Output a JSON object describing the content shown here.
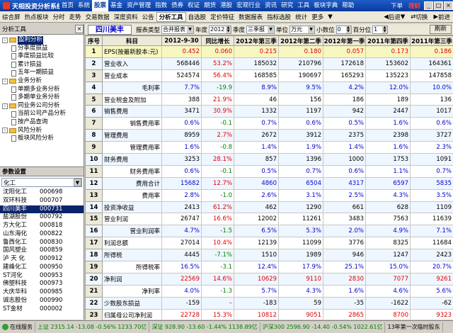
{
  "app": {
    "title": "天相投资分析系统"
  },
  "menu": [
    "首页",
    "系统",
    "股票",
    "基金",
    "资产管理",
    "指数",
    "债券",
    "权证",
    "期货",
    "港股",
    "宏观行业",
    "资讯",
    "研究",
    "工具",
    "板块字典",
    "帮助"
  ],
  "menu_active": 2,
  "menu_right": [
    "下单",
    "理财"
  ],
  "toolbar": [
    "综合屏",
    "热点板块",
    "分时",
    "走势",
    "交易数据",
    "深度资料",
    "公告",
    "分析工具",
    "自选股",
    "定价特征",
    "数据报表",
    "指标选股",
    "统计",
    "更多"
  ],
  "toolbar_active": 7,
  "toolbar_right": [
    "后退",
    "切换",
    "前进"
  ],
  "left": {
    "title": "分析工具",
    "tree": [
      {
        "t": "盈利分析",
        "lvl": 0,
        "pm": "-",
        "sel": true
      },
      {
        "t": "分季度损益",
        "lvl": 1
      },
      {
        "t": "季度损益比较",
        "lvl": 1
      },
      {
        "t": "累计损益",
        "lvl": 1
      },
      {
        "t": "五年一期损益",
        "lvl": 1
      },
      {
        "t": "业务分析",
        "lvl": 0,
        "pm": "-"
      },
      {
        "t": "单期多业务分析",
        "lvl": 1
      },
      {
        "t": "多期单业务分析",
        "lvl": 1
      },
      {
        "t": "同业务公司分析",
        "lvl": 0,
        "pm": "-"
      },
      {
        "t": "当前公司产品分析",
        "lvl": 1
      },
      {
        "t": "按产品查询",
        "lvl": 1
      },
      {
        "t": "风险分析",
        "lvl": 0,
        "pm": "-"
      },
      {
        "t": "板块风险分析",
        "lvl": 1
      }
    ],
    "param_title": "参数设置",
    "sector": "化工",
    "stocks": [
      [
        "沈阳化工",
        "000698"
      ],
      [
        "双环科技",
        "000707"
      ],
      [
        "四川美丰",
        "000731"
      ],
      [
        "盐湖股份",
        "000792"
      ],
      [
        "方大化工",
        "000818"
      ],
      [
        "山东海化",
        "000822"
      ],
      [
        "鲁西化工",
        "000830"
      ],
      [
        "国风塑业",
        "000859"
      ],
      [
        "泸 天 化",
        "000912"
      ],
      [
        "建峰化工",
        "000950"
      ],
      [
        "ST河化",
        "000953"
      ],
      [
        "佛塑科技",
        "000973"
      ],
      [
        "大庆华科",
        "000985"
      ],
      [
        "诚志股份",
        "000990"
      ],
      [
        "ST金材",
        "000002"
      ]
    ],
    "stock_sel": 2
  },
  "ctrl": {
    "stock": "四川美丰",
    "type_label": "报表类型",
    "type_val": "合并报表",
    "year_label": "年度",
    "year_val": "2012",
    "quarter_label": "季度",
    "quarter_val": "三季报",
    "unit_label": "单位",
    "unit_val": "万元",
    "dec_label": "小数位",
    "dec_val": "0",
    "pct_label": "百分位",
    "pct_val": "1",
    "refresh": "刷新"
  },
  "table": {
    "headers": [
      "序号",
      "科目",
      "2012-9-30",
      "同比增长",
      "2012年第三季",
      "2012年第二季",
      "2012年第一季",
      "2011年第四季",
      "2011年第三季"
    ],
    "rows": [
      [
        1,
        "EPS(按最新股本:元)",
        0,
        "0.452",
        "0.060",
        "0.215",
        "0.180",
        "0.057",
        "0.173",
        "0.186"
      ],
      [
        2,
        "营业收入",
        0,
        "568446",
        "53.2%",
        "185032",
        "210796",
        "172618",
        "153602",
        "164361"
      ],
      [
        3,
        "营业成本",
        0,
        "524574",
        "56.4%",
        "168585",
        "190697",
        "165293",
        "135223",
        "147858"
      ],
      [
        4,
        "毛利率",
        1,
        "7.7%",
        "-19.9",
        "8.9%",
        "9.5%",
        "4.2%",
        "12.0%",
        "10.0%"
      ],
      [
        5,
        "营业税金及附加",
        0,
        "388",
        "21.9%",
        "46",
        "156",
        "186",
        "189",
        "136"
      ],
      [
        6,
        "销售费用",
        0,
        "3471",
        "30.9%",
        "1332",
        "1197",
        "942",
        "2447",
        "1017"
      ],
      [
        7,
        "销售费用率",
        1,
        "0.6%",
        "-0.1",
        "0.7%",
        "0.6%",
        "0.5%",
        "1.6%",
        "0.6%"
      ],
      [
        8,
        "管理费用",
        0,
        "8959",
        "2.7%",
        "2672",
        "3912",
        "2375",
        "2398",
        "3727"
      ],
      [
        9,
        "管理费用率",
        1,
        "1.6%",
        "-0.8",
        "1.4%",
        "1.9%",
        "1.4%",
        "1.6%",
        "2.3%"
      ],
      [
        10,
        "财务费用",
        0,
        "3253",
        "28.1%",
        "857",
        "1396",
        "1000",
        "1753",
        "1091"
      ],
      [
        11,
        "财务费用率",
        1,
        "0.6%",
        "-0.1",
        "0.5%",
        "0.7%",
        "0.6%",
        "1.1%",
        "0.7%"
      ],
      [
        12,
        "费用合计",
        1,
        "15682",
        "12.7%",
        "4860",
        "6504",
        "4317",
        "6597",
        "5835"
      ],
      [
        13,
        "费用率",
        1,
        "2.8%",
        "-1.0",
        "2.6%",
        "3.1%",
        "2.5%",
        "4.3%",
        "3.5%"
      ],
      [
        14,
        "投资净收益",
        0,
        "2413",
        "61.2%",
        "462",
        "1290",
        "661",
        "628",
        "1109"
      ],
      [
        15,
        "营业利润",
        0,
        "26747",
        "16.6%",
        "12002",
        "11261",
        "3483",
        "7563",
        "11639"
      ],
      [
        16,
        "营业利润率",
        1,
        "4.7%",
        "-1.5",
        "6.5%",
        "5.3%",
        "2.0%",
        "4.9%",
        "7.1%"
      ],
      [
        17,
        "利润总额",
        0,
        "27014",
        "10.4%",
        "12139",
        "11099",
        "3776",
        "8325",
        "11684"
      ],
      [
        18,
        "所得税",
        0,
        "4445",
        "-7.1%",
        "1510",
        "1989",
        "946",
        "1247",
        "2423"
      ],
      [
        19,
        "所得税率",
        1,
        "16.5%",
        "-3.1",
        "12.4%",
        "17.9%",
        "25.1%",
        "15.0%",
        "20.7%"
      ],
      [
        20,
        "净利润",
        0,
        "22569",
        "14.6%",
        "10629",
        "9110",
        "2830",
        "7077",
        "9261"
      ],
      [
        21,
        "净利率",
        1,
        "4.0%",
        "-1.3",
        "5.7%",
        "4.3%",
        "1.6%",
        "4.6%",
        "5.6%"
      ],
      [
        22,
        "少数股东损益",
        0,
        "-159",
        "–",
        "-183",
        "59",
        "-35",
        "-1622",
        "-62"
      ],
      [
        23,
        "归属母公司净利润",
        0,
        "22728",
        "15.3%",
        "10812",
        "9051",
        "2865",
        "8700",
        "9323"
      ]
    ],
    "sel_row": 0
  },
  "status": [
    "在线服务",
    "上证 2315.14 -13.08 -0.56% 1233.70亿",
    "深证 928.90 -13.60 -1.44% 1138.89亿",
    "沪深300 2596.90 -14.40 -0.54% 1022.61亿",
    "13年第一次临时股东"
  ]
}
